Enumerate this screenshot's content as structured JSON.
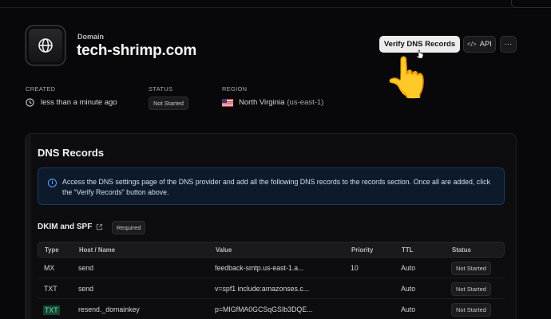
{
  "header": {
    "domain_label": "Domain",
    "domain_name": "tech-shrimp.com",
    "verify_button": "Verify DNS Records",
    "api_button": "API",
    "more_button": "···",
    "hand_emoji": "👆"
  },
  "meta": {
    "created_label": "CREATED",
    "created_value": "less than a minute ago",
    "status_label": "STATUS",
    "status_value": "Not Started",
    "region_label": "REGION",
    "region_value": "North Virginia",
    "region_code": "(us-east-1)"
  },
  "dns": {
    "title": "DNS Records",
    "info_text": "Access the DNS settings page of the DNS provider and add all the following DNS records to the records section. Once all are added, click the “Verify Records” button above.",
    "section_title": "DKIM and SPF",
    "required_badge": "Required",
    "columns": [
      "Type",
      "Host / Name",
      "Value",
      "Priority",
      "TTL",
      "Status"
    ],
    "rows": [
      {
        "type": "MX",
        "host": "send",
        "value": "feedback-smtp.us-east-1.a...",
        "priority": "10",
        "ttl": "Auto",
        "status": "Not Started"
      },
      {
        "type": "TXT",
        "host": "send",
        "value": "v=spf1 include:amazonses.c...",
        "priority": "",
        "ttl": "Auto",
        "status": "Not Started"
      },
      {
        "type": "TXT",
        "host": "resend._domainkey",
        "value": "p=MIGfMA0GCSqGSIb3DQE...",
        "priority": "",
        "ttl": "Auto",
        "status": "Not Started"
      }
    ]
  },
  "colors": {
    "background": "#08080a",
    "info_bg": "#0c1a2c",
    "info_border": "#1a3a5f",
    "highlight": "#12452f"
  }
}
